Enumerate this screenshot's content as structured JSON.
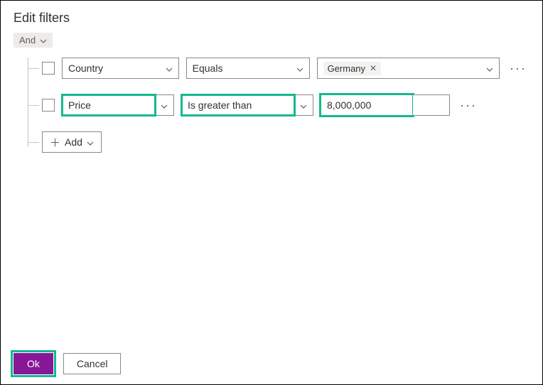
{
  "title": "Edit filters",
  "group_operator": "And",
  "rows": [
    {
      "field": "Country",
      "operator": "Equals",
      "value_chip": "Germany"
    },
    {
      "field": "Price",
      "operator": "Is greater than",
      "value_text": "8,000,000"
    }
  ],
  "add_label": "Add",
  "footer": {
    "ok": "Ok",
    "cancel": "Cancel"
  }
}
